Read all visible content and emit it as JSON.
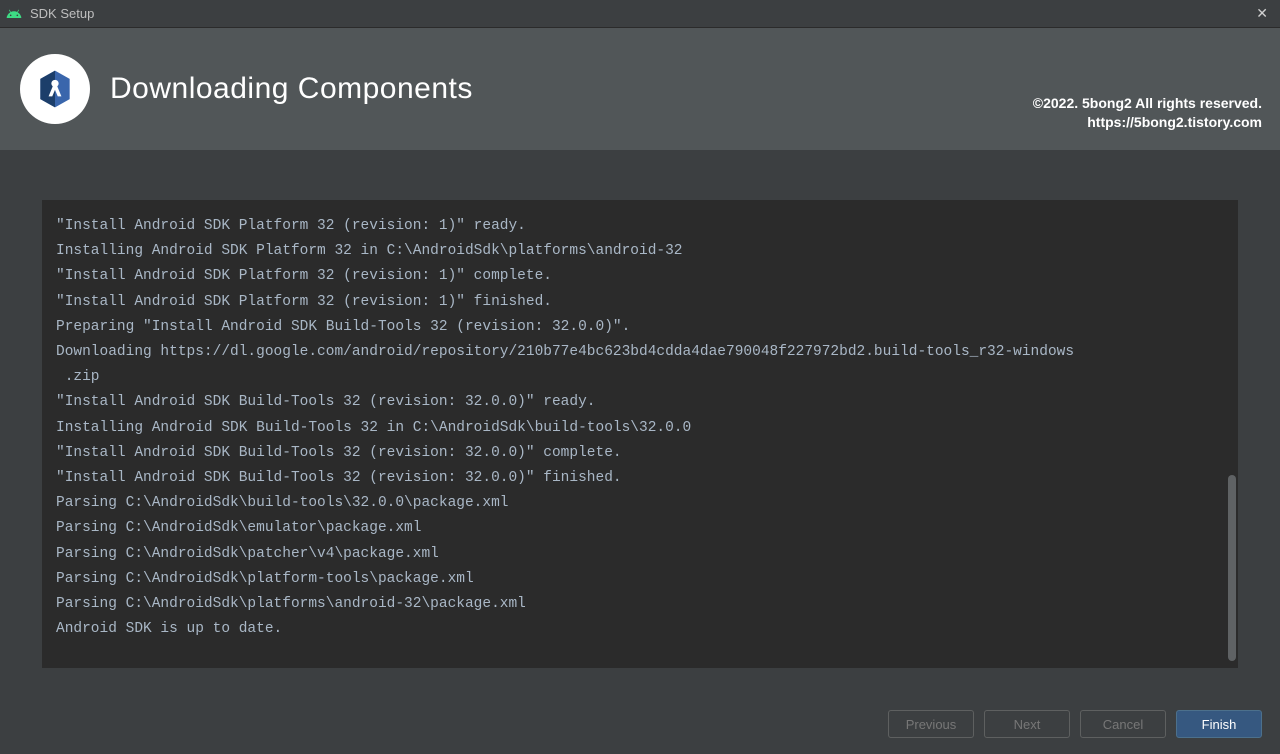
{
  "window": {
    "title": "SDK Setup"
  },
  "header": {
    "title": "Downloading Components",
    "copyright_line1": "©2022. 5bong2 All rights reserved.",
    "copyright_line2": "https://5bong2.tistory.com"
  },
  "log": {
    "text": "\"Install Android SDK Platform 32 (revision: 1)\" ready.\nInstalling Android SDK Platform 32 in C:\\AndroidSdk\\platforms\\android-32\n\"Install Android SDK Platform 32 (revision: 1)\" complete.\n\"Install Android SDK Platform 32 (revision: 1)\" finished.\nPreparing \"Install Android SDK Build-Tools 32 (revision: 32.0.0)\".\nDownloading https://dl.google.com/android/repository/210b77e4bc623bd4cdda4dae790048f227972bd2.build-tools_r32-windows\n .zip\n\"Install Android SDK Build-Tools 32 (revision: 32.0.0)\" ready.\nInstalling Android SDK Build-Tools 32 in C:\\AndroidSdk\\build-tools\\32.0.0\n\"Install Android SDK Build-Tools 32 (revision: 32.0.0)\" complete.\n\"Install Android SDK Build-Tools 32 (revision: 32.0.0)\" finished.\nParsing C:\\AndroidSdk\\build-tools\\32.0.0\\package.xml\nParsing C:\\AndroidSdk\\emulator\\package.xml\nParsing C:\\AndroidSdk\\patcher\\v4\\package.xml\nParsing C:\\AndroidSdk\\platform-tools\\package.xml\nParsing C:\\AndroidSdk\\platforms\\android-32\\package.xml\nAndroid SDK is up to date."
  },
  "footer": {
    "previous": "Previous",
    "next": "Next",
    "cancel": "Cancel",
    "finish": "Finish"
  }
}
